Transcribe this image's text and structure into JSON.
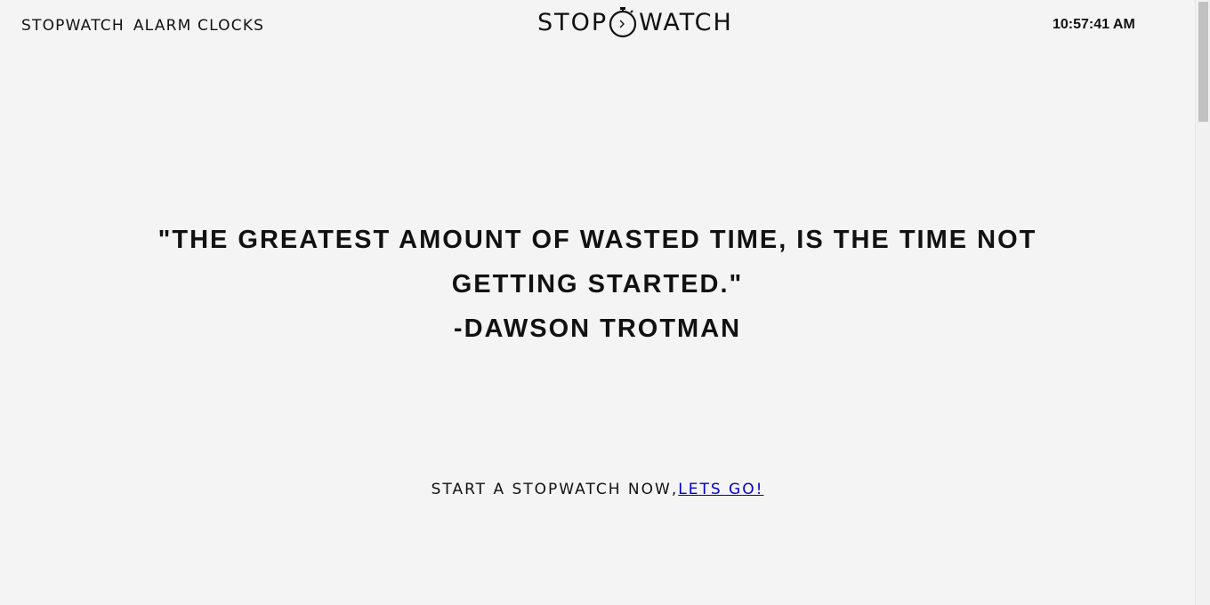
{
  "nav": {
    "stopwatch": "STOPWATCH",
    "alarm_clocks": "ALARM CLOCKS"
  },
  "logo": {
    "left": "STOP",
    "right": "WATCH",
    "icon": "stopwatch-icon"
  },
  "clock": {
    "time": "10:57:41 AM"
  },
  "quote": {
    "line1": "\"THE GREATEST AMOUNT OF WASTED TIME, IS THE TIME NOT",
    "line2": "GETTING STARTED.\"",
    "author": "-DAWSON TROTMAN"
  },
  "cta": {
    "text": "START A STOPWATCH NOW,",
    "link": "LETS GO!",
    "link_color": "#0000cc"
  },
  "colors": {
    "background": "#f4f4f4",
    "text": "#111111"
  }
}
